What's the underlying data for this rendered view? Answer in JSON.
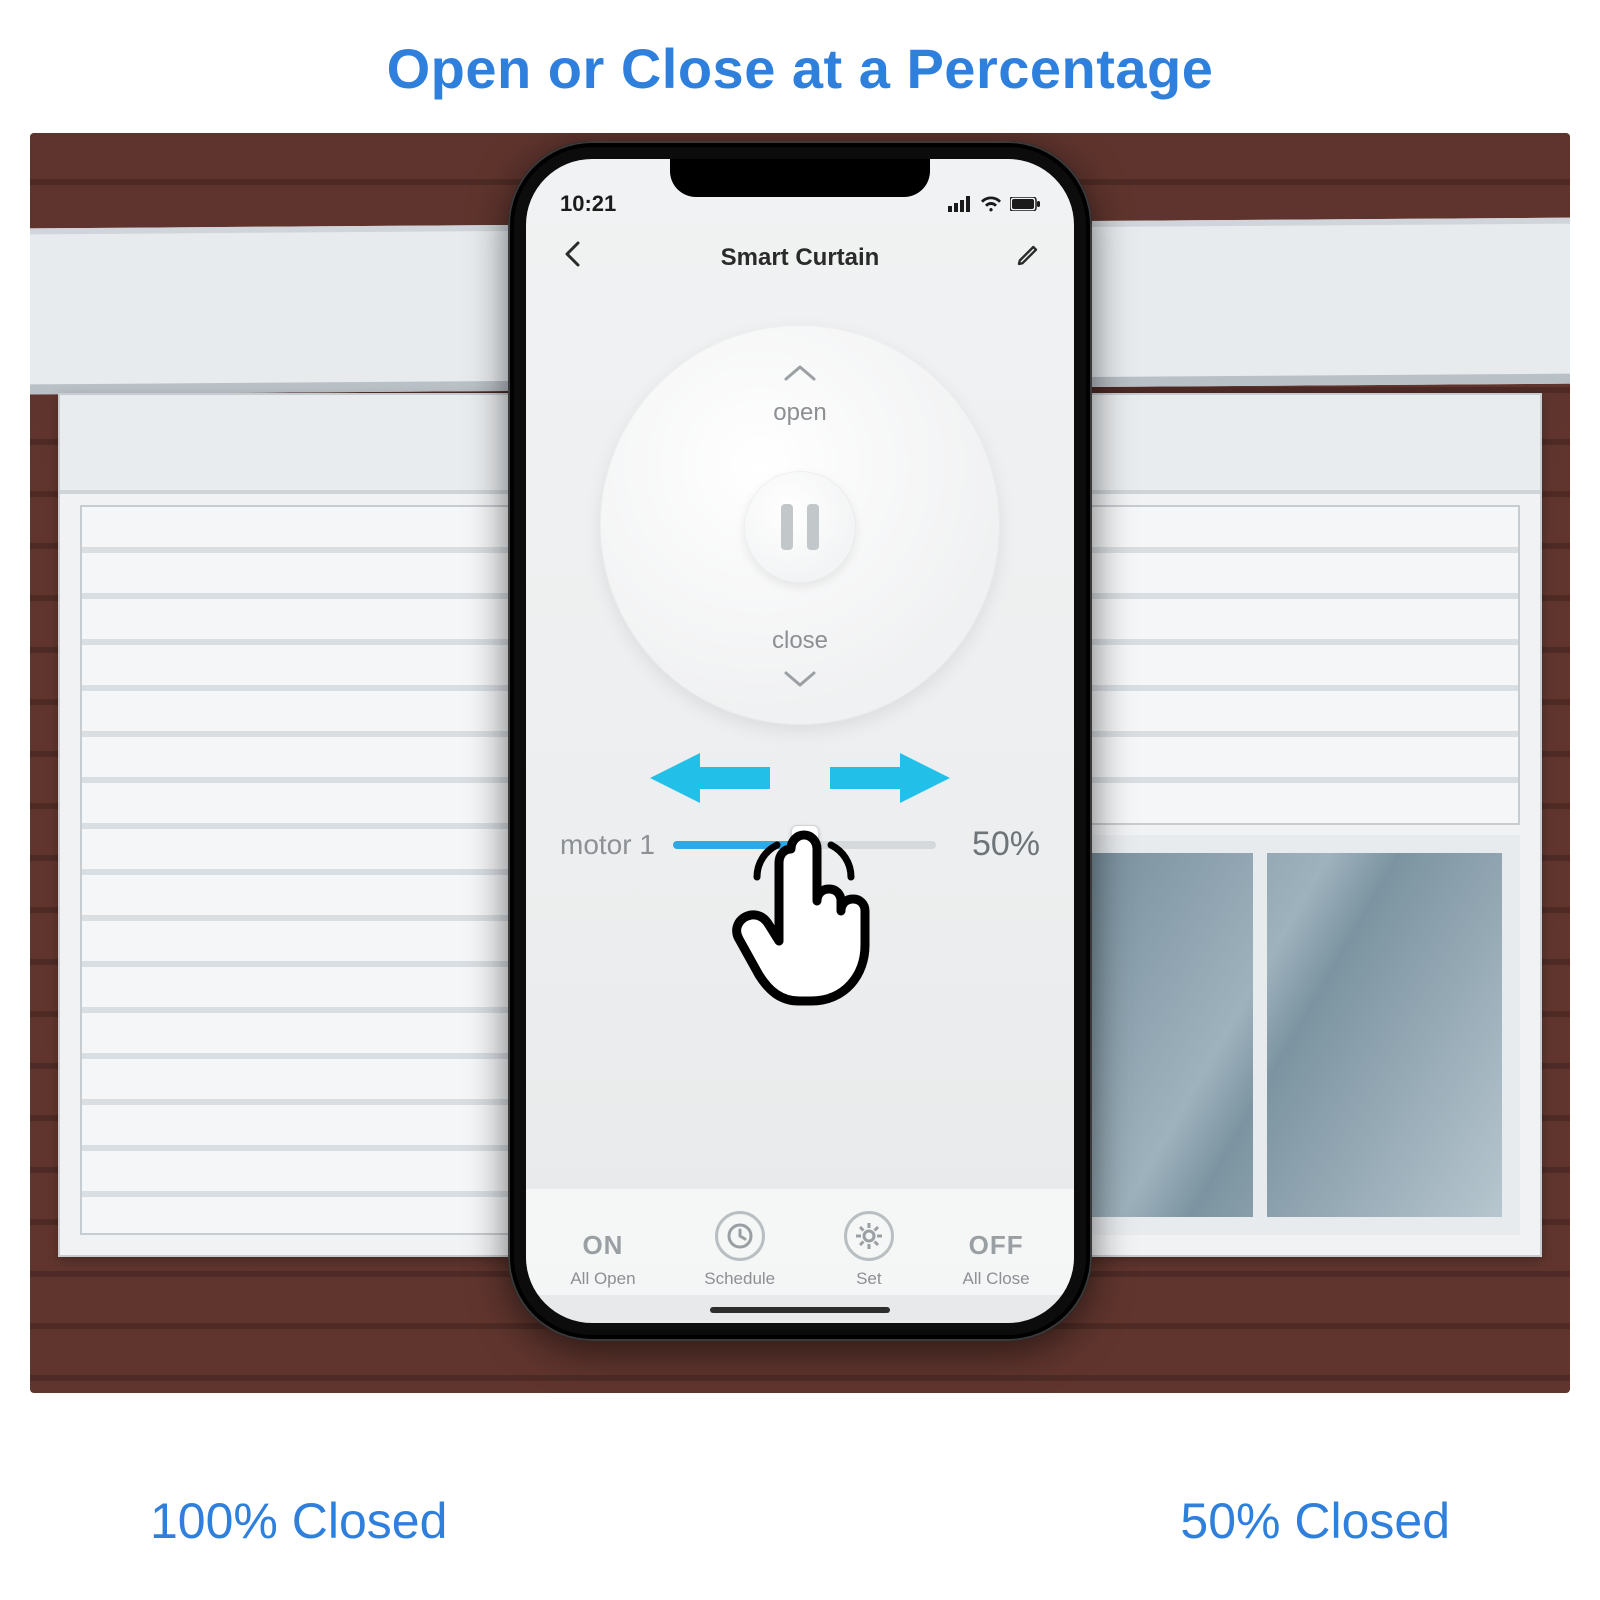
{
  "headline": "Open or Close at a Percentage",
  "captions": {
    "left": "100% Closed",
    "right": "50% Closed"
  },
  "phone": {
    "status": {
      "time": "10:21"
    },
    "nav": {
      "title": "Smart Curtain"
    },
    "dial": {
      "open_label": "open",
      "close_label": "close"
    },
    "slider": {
      "label": "motor 1",
      "percent_text": "50%",
      "percent": 50
    },
    "bottom": {
      "on": {
        "big": "ON",
        "small": "All Open"
      },
      "schedule": {
        "small": "Schedule"
      },
      "set": {
        "small": "Set"
      },
      "off": {
        "big": "OFF",
        "small": "All Close"
      }
    }
  }
}
